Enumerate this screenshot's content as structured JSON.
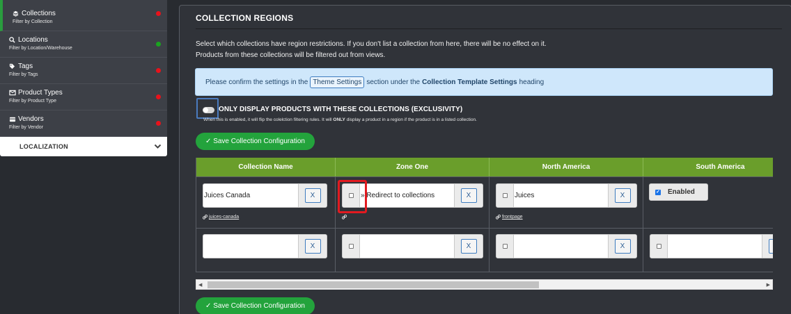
{
  "sidebar": {
    "items": [
      {
        "label": "Collections",
        "sub": "Filter by Collection",
        "status": "red",
        "icon": "layers-icon"
      },
      {
        "label": "Locations",
        "sub": "Filter by Location/Warehouse",
        "status": "green",
        "icon": "search-location-icon"
      },
      {
        "label": "Tags",
        "sub": "Filter by Tags",
        "status": "red",
        "icon": "tag-icon"
      },
      {
        "label": "Product Types",
        "sub": "Filter by Product Type",
        "status": "red",
        "icon": "product-type-icon"
      },
      {
        "label": "Vendors",
        "sub": "Filter by Vendor",
        "status": "red",
        "icon": "vendor-icon"
      }
    ],
    "localization": "LOCALIZATION"
  },
  "panel": {
    "title": "COLLECTION REGIONS",
    "description": "Select which collections have region restrictions. If you don't list a collection from here, there will be no effect on it. Products from these collections will be filtered out from views.",
    "info": {
      "before": "Please confirm the settings in the",
      "button": "Theme Settings",
      "middle": "section under the",
      "bold": "Collection Template Settings",
      "after": "heading"
    },
    "exclusivity": {
      "title": "ONLY DISPLAY PRODUCTS WITH THESE COLLECTIONS (EXCLUSIVITY)",
      "note_before": "When this is enabled, it will flip the colelction filtering rules. It will",
      "note_bold": "ONLY",
      "note_after": "display a product in a region if the product is in a listed collection.",
      "enabled": false
    },
    "save_label": "✓ Save Collection Configuration"
  },
  "table": {
    "headers": [
      "Collection Name",
      "Zone One",
      "North America",
      "South America"
    ],
    "row1": {
      "collection": "Juices Canada",
      "collection_link": "juices-canada",
      "zone_one": "» Redirect to collections",
      "north_america": "Juices",
      "north_america_link": "frontpage",
      "south_america": "Enabled",
      "remove": "X"
    },
    "row2": {
      "collection": "",
      "zone_one": "",
      "north_america": "",
      "remove": "X"
    }
  },
  "colors": {
    "accent_green": "#23a33c",
    "table_header": "#6a9e2b",
    "status_red": "#e8121b",
    "status_green": "#1aa31f"
  }
}
